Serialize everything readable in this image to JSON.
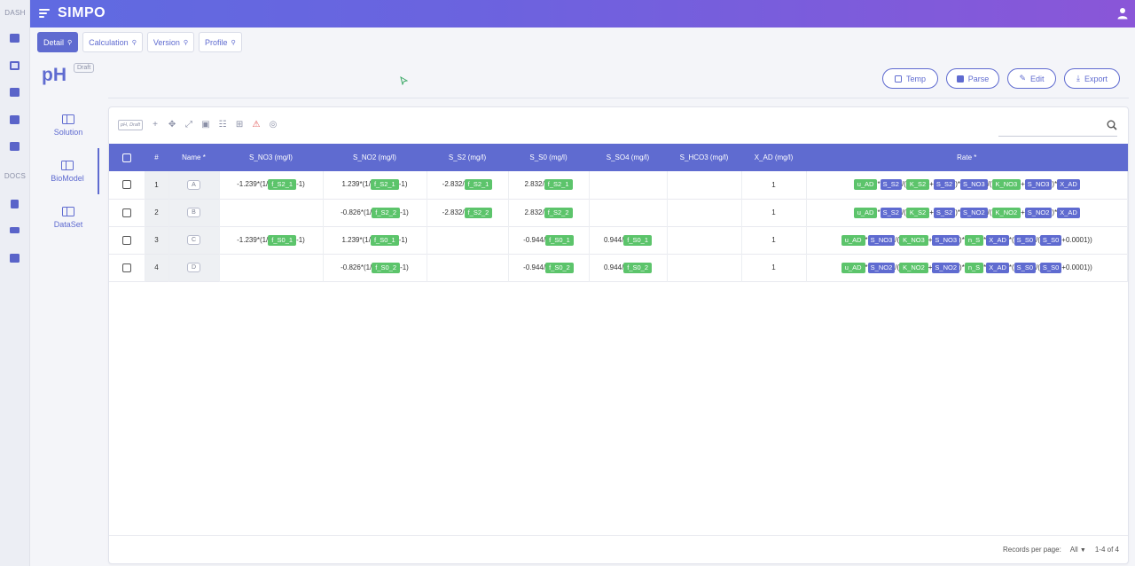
{
  "app": {
    "brand": "SIMPO"
  },
  "rail": {
    "section1": "DASH",
    "section2": "DOCS"
  },
  "tabs": [
    {
      "label": "Detail",
      "active": true
    },
    {
      "label": "Calculation",
      "active": false
    },
    {
      "label": "Version",
      "active": false
    },
    {
      "label": "Profile",
      "active": false
    }
  ],
  "page": {
    "title": "pH",
    "badge": "Draft"
  },
  "actions": [
    {
      "label": "Temp",
      "icon": "save-icon"
    },
    {
      "label": "Parse",
      "icon": "save-solid-icon"
    },
    {
      "label": "Edit",
      "icon": "pencil-icon"
    },
    {
      "label": "Export",
      "icon": "download-icon"
    }
  ],
  "sidenav": [
    {
      "label": "Solution",
      "icon": "solution-icon",
      "active": false
    },
    {
      "label": "BioModel",
      "icon": "biomodel-icon",
      "active": true
    },
    {
      "label": "DataSet",
      "icon": "dataset-icon",
      "active": false
    }
  ],
  "toolbar": {
    "tag": "pH, Draft"
  },
  "table": {
    "headers": [
      "#",
      "Name *",
      "S_NO3 (mg/l)",
      "S_NO2 (mg/l)",
      "S_S2 (mg/l)",
      "S_S0 (mg/l)",
      "S_SO4 (mg/l)",
      "S_HCO3 (mg/l)",
      "X_AD (mg/l)",
      "Rate *"
    ],
    "rows": [
      {
        "num": "1",
        "name": "A",
        "no3": [
          "-1.239*(1/",
          "f_S2_1",
          "-1)"
        ],
        "no2": [
          "1.239*(1/",
          "f_S2_1",
          "-1)"
        ],
        "s2": [
          "-2.832/",
          "f_S2_1"
        ],
        "s0": [
          "2.832/",
          "f_S2_1"
        ],
        "so4": [],
        "hco3": "",
        "xad": "1",
        "rate": [
          "u_AD",
          "*",
          "S_S2",
          "/(",
          "K_S2",
          "+",
          "S_S2",
          ")*",
          "S_NO3",
          "/(",
          "K_NO3",
          "+",
          "S_NO3",
          ")*",
          "X_AD"
        ]
      },
      {
        "num": "2",
        "name": "B",
        "no3": [],
        "no2": [
          "-0.826*(1/",
          "f_S2_2",
          "-1)"
        ],
        "s2": [
          "-2.832/",
          "f_S2_2"
        ],
        "s0": [
          "2.832/",
          "f_S2_2"
        ],
        "so4": [],
        "hco3": "",
        "xad": "1",
        "rate": [
          "u_AD",
          "*",
          "S_S2",
          "/(",
          "K_S2",
          "+",
          "S_S2",
          ")*",
          "S_NO2",
          "/(",
          "K_NO2",
          "+",
          "S_NO2",
          ")*",
          "X_AD"
        ]
      },
      {
        "num": "3",
        "name": "C",
        "no3": [
          "-1.239*(1/",
          "f_S0_1",
          "-1)"
        ],
        "no2": [
          "1.239*(1/",
          "f_S0_1",
          "-1)"
        ],
        "s2": [],
        "s0": [
          "-0.944/",
          "f_S0_1"
        ],
        "so4": [
          "0.944/",
          "f_S0_1"
        ],
        "hco3": "",
        "xad": "1",
        "rate": [
          "u_AD",
          "*",
          "S_NO3",
          "/(",
          "K_NO3",
          "+",
          "S_NO3",
          ")*",
          "n_S",
          "*",
          "X_AD",
          "*(",
          "S_S0",
          "/(",
          "S_S0",
          "+0.0001))"
        ]
      },
      {
        "num": "4",
        "name": "D",
        "no3": [],
        "no2": [
          "-0.826*(1/",
          "f_S0_2",
          "-1)"
        ],
        "s2": [],
        "s0": [
          "-0.944/",
          "f_S0_2"
        ],
        "so4": [
          "0.944/",
          "f_S0_2"
        ],
        "hco3": "",
        "xad": "1",
        "rate": [
          "u_AD",
          "*",
          "S_NO2",
          "/(",
          "K_NO2",
          "+",
          "S_NO2",
          ")*",
          "n_S",
          "*",
          "X_AD",
          "*(",
          "S_S0",
          "/(",
          "S_S0",
          "+0.0001))"
        ]
      }
    ]
  },
  "footer": {
    "records_label": "Records per page:",
    "records_value": "All",
    "range": "1-4 of 4"
  },
  "colors": {
    "accent": "#5f6bd0",
    "green_chip": "#5cc46b",
    "warn": "#e04f4f"
  }
}
